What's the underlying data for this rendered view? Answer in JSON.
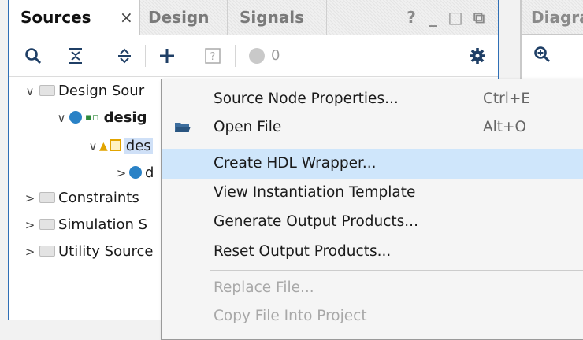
{
  "sources_panel": {
    "tabs": [
      {
        "label": "Sources",
        "active": true
      },
      {
        "label": "Design",
        "active": false
      },
      {
        "label": "Signals",
        "active": false
      }
    ],
    "close_glyph": "×",
    "window_buttons": [
      "?",
      "_",
      "□",
      "⧉"
    ],
    "toolbar": {
      "icons": [
        "search-icon",
        "collapse-all-icon",
        "expand-all-icon",
        "add-icon",
        "help-icon",
        "status-dot-icon",
        "gear-icon"
      ],
      "status_count": "0"
    },
    "tree": [
      {
        "label": "Design Sour",
        "caret": "∨",
        "icon": "folder-icon"
      },
      {
        "label": "desig",
        "caret": "∨",
        "icon": "block-design-icon"
      },
      {
        "label": "des",
        "caret": "∨",
        "icon": "ip-icon"
      },
      {
        "label": "d",
        "caret": ">",
        "icon": "module-icon"
      },
      {
        "label": "Constraints",
        "caret": ">",
        "icon": "folder-icon"
      },
      {
        "label": "Simulation S",
        "caret": ">",
        "icon": "folder-icon"
      },
      {
        "label": "Utility Source",
        "caret": ">",
        "icon": "folder-icon"
      }
    ]
  },
  "diagram_panel": {
    "tab_label": "Diagra"
  },
  "context_menu": {
    "items": [
      {
        "label": "Source Node Properties...",
        "shortcut": "Ctrl+E",
        "icon": "",
        "state": "normal"
      },
      {
        "label": "Open File",
        "shortcut": "Alt+O",
        "icon": "open-folder-icon",
        "state": "normal"
      },
      {
        "label": "Create HDL Wrapper...",
        "shortcut": "",
        "icon": "",
        "state": "hover"
      },
      {
        "label": "View Instantiation Template",
        "shortcut": "",
        "icon": "",
        "state": "normal"
      },
      {
        "label": "Generate Output Products...",
        "shortcut": "",
        "icon": "",
        "state": "normal"
      },
      {
        "label": "Reset Output Products...",
        "shortcut": "",
        "icon": "",
        "state": "normal"
      },
      {
        "label": "Replace File...",
        "shortcut": "",
        "icon": "",
        "state": "disabled"
      },
      {
        "label": "Copy File Into Project",
        "shortcut": "",
        "icon": "",
        "state": "disabled"
      }
    ]
  },
  "colors": {
    "accent": "#2f6fb6",
    "hover": "#cfe6fb",
    "tree_highlight": "#cfe0f7",
    "warning": "#e2a400"
  }
}
